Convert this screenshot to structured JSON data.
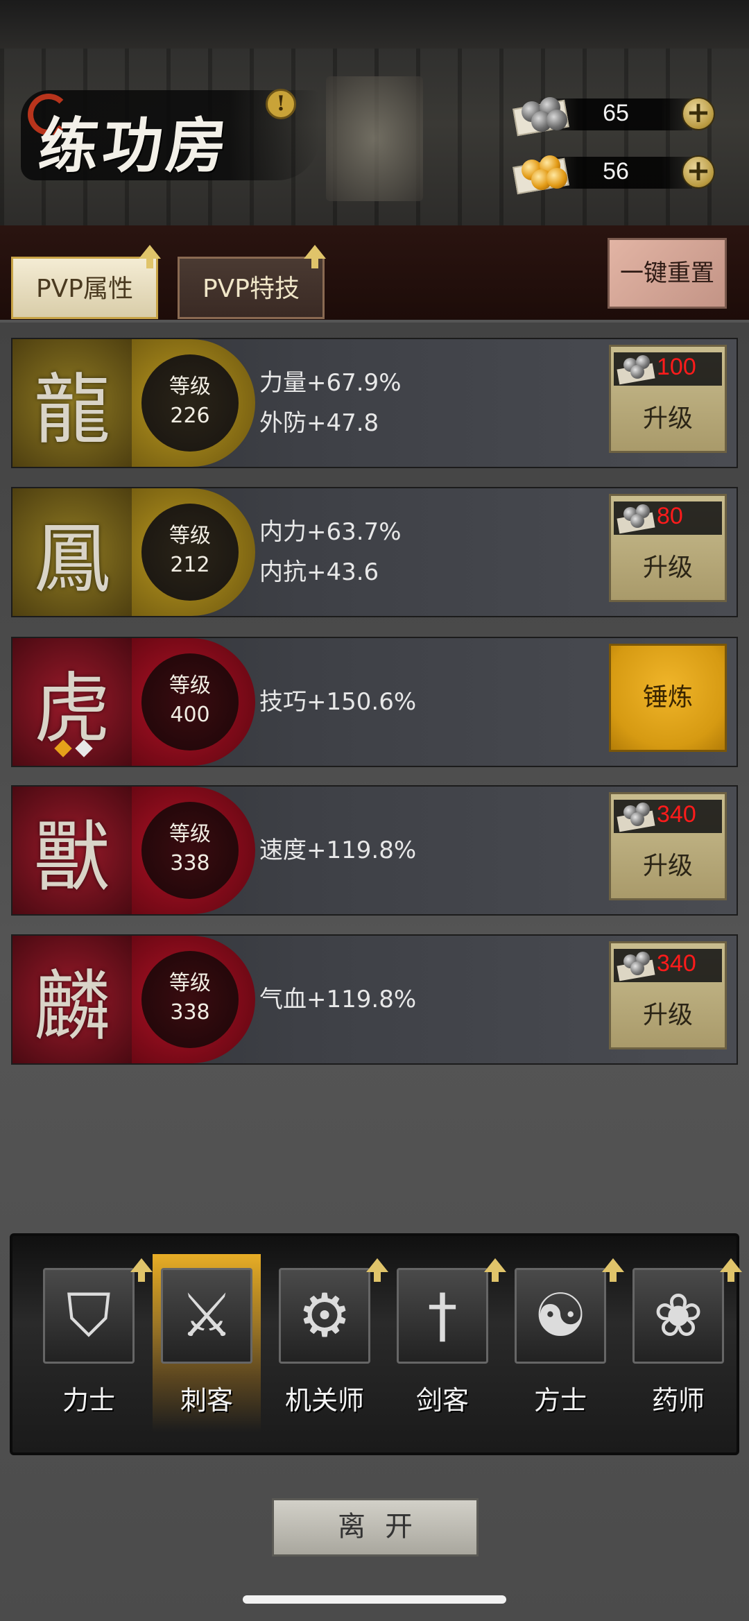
{
  "header": {
    "title": "练功房",
    "currencies": [
      {
        "name": "iron-pellets",
        "amount": "65"
      },
      {
        "name": "gold-pellets",
        "amount": "56"
      }
    ]
  },
  "tabs": {
    "pvp_attributes": "PVP属性",
    "pvp_skills": "PVP特技",
    "reset_all": "一键重置"
  },
  "rows": [
    {
      "tier": "gold",
      "level_label": "等级",
      "level": "226",
      "stats": [
        "力量+67.9%",
        "外防+47.8"
      ],
      "cost": "100",
      "action": "升级",
      "emblem": "dragon-icon"
    },
    {
      "tier": "gold",
      "level_label": "等级",
      "level": "212",
      "stats": [
        "内力+63.7%",
        "内抗+43.6"
      ],
      "cost": "80",
      "action": "升级",
      "emblem": "phoenix-icon"
    },
    {
      "tier": "red",
      "level_label": "等级",
      "level": "400",
      "stats": [
        "技巧+150.6%"
      ],
      "cost": "",
      "action": "锤炼",
      "emblem": "tiger-icon"
    },
    {
      "tier": "red",
      "level_label": "等级",
      "level": "338",
      "stats": [
        "速度+119.8%"
      ],
      "cost": "340",
      "action": "升级",
      "emblem": "beast-icon"
    },
    {
      "tier": "red",
      "level_label": "等级",
      "level": "338",
      "stats": [
        "气血+119.8%"
      ],
      "cost": "340",
      "action": "升级",
      "emblem": "qilin-icon"
    }
  ],
  "classes": [
    {
      "name": "力士",
      "icon": "shield-icon",
      "selected": false
    },
    {
      "name": "刺客",
      "icon": "claw-dagger-icon",
      "selected": true
    },
    {
      "name": "机关师",
      "icon": "gears-icon",
      "selected": false
    },
    {
      "name": "剑客",
      "icon": "sword-icon",
      "selected": false
    },
    {
      "name": "方士",
      "icon": "yin-yang-icon",
      "selected": false
    },
    {
      "name": "药师",
      "icon": "gourd-icon",
      "selected": false
    }
  ],
  "leave_label": "离开",
  "colors": {
    "cost_red": "#ff1b1b",
    "gold_tier": "#b8971f",
    "red_tier": "#b01226",
    "forge_orange": "#e0a41e"
  }
}
